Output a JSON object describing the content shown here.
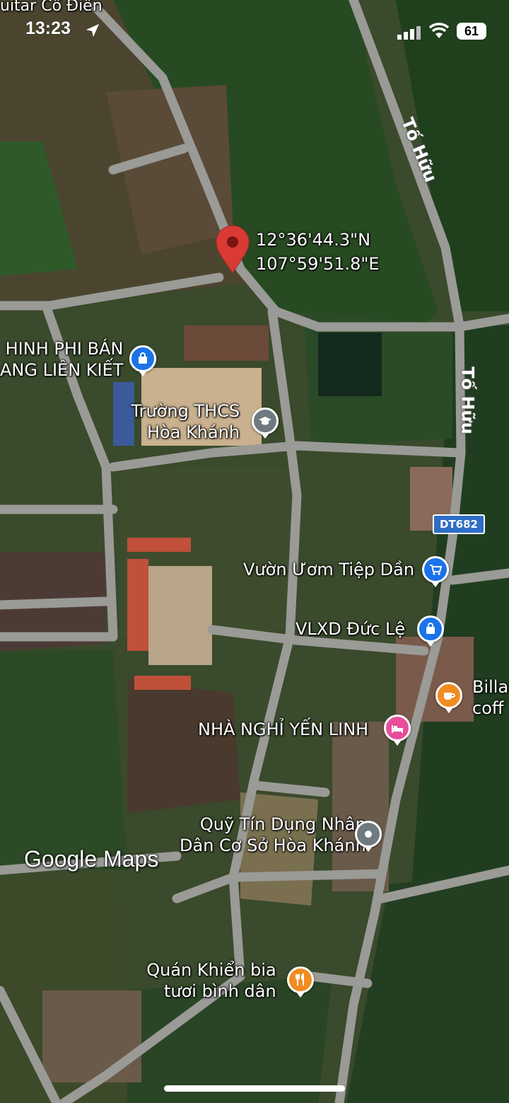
{
  "status_bar": {
    "time": "13:23",
    "battery": "61",
    "location_icon": "location-arrow-icon",
    "signal_icon": "cellular-signal-icon",
    "wifi_icon": "wifi-icon"
  },
  "top_partial_label": "uitar Cổ Điển",
  "pin": {
    "lat": "12°36'44.3\"N",
    "lng": "107°59'51.8\"E",
    "color": "#d93a33"
  },
  "roads": {
    "to_huu_1": "Tố Hữu",
    "to_huu_2": "Tố Hữu",
    "route_shield": "DT682"
  },
  "places": [
    {
      "line1": "HINH PHI BÁN",
      "line2": "ANG LIÊN KIẾT",
      "icon": "shopping-bag-icon",
      "color": "#1a73e8"
    },
    {
      "line1": "Trường THCS",
      "line2": "Hòa Khánh",
      "icon": "graduation-cap-icon",
      "color": "#6e7a80"
    },
    {
      "line1": "Vườn Ươm Tiệp Dần",
      "icon": "shopping-cart-icon",
      "color": "#1a73e8"
    },
    {
      "line1": "VLXD Đức Lệ",
      "icon": "shopping-bag-icon",
      "color": "#1a73e8"
    },
    {
      "line1": "Billa",
      "line2": "coff",
      "icon": "coffee-cup-icon",
      "color": "#f28b20"
    },
    {
      "line1": "NHÀ NGHỈ YẾN LINH",
      "icon": "bed-icon",
      "color": "#e84e9b"
    },
    {
      "line1": "Quỹ Tín Dụng Nhân",
      "line2": "Dân Cơ Sở Hòa Khánh",
      "icon": "pin-dot-icon",
      "color": "#6e7a80"
    },
    {
      "line1": "Quán Khiển bia",
      "line2": "tươi bình dân",
      "icon": "fork-knife-icon",
      "color": "#f28b20"
    }
  ],
  "branding": {
    "logo": "Google Maps"
  }
}
